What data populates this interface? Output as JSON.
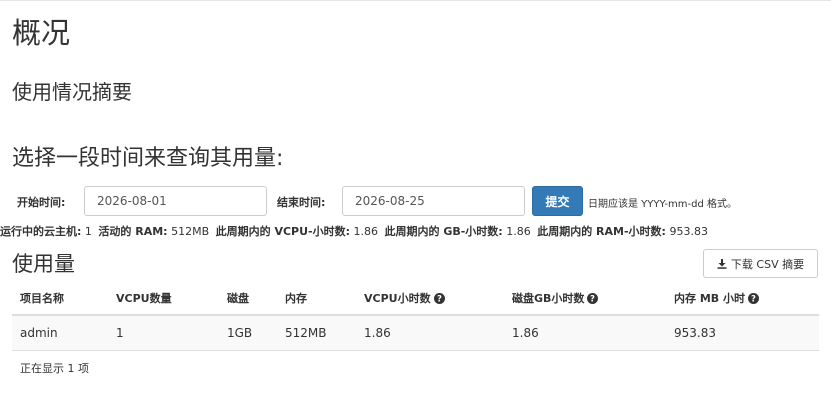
{
  "page": {
    "title": "概况",
    "summary_title": "使用情况摘要",
    "query_title": "选择一段时间来查询其用量:"
  },
  "form": {
    "start_label": "开始时间:",
    "start_value": "2026-08-01",
    "end_label": "结束时间:",
    "end_value": "2026-08-25",
    "submit_label": "提交",
    "hint": "日期应该是 YYYY-mm-dd 格式。"
  },
  "stats": {
    "instances_label": "运行中的云主机:",
    "instances_value": "1",
    "ram_label": "活动的 RAM:",
    "ram_value": "512MB",
    "vcpu_hours_label": "此周期内的 VCPU-小时数:",
    "vcpu_hours_value": "1.86",
    "gb_hours_label": "此周期内的 GB-小时数:",
    "gb_hours_value": "1.86",
    "ram_hours_label": "此周期内的 RAM-小时数:",
    "ram_hours_value": "953.83"
  },
  "usage": {
    "title": "使用量",
    "csv_button": "下载 CSV 摘要",
    "columns": [
      "项目名称",
      "VCPU数量",
      "磁盘",
      "内存",
      "VCPU小时数",
      "磁盘GB小时数",
      "内存 MB 小时"
    ],
    "rows": [
      [
        "admin",
        "1",
        "1GB",
        "512MB",
        "1.86",
        "1.86",
        "953.83"
      ]
    ],
    "footer": "正在显示 1 项"
  },
  "icons": {
    "download": "download-icon",
    "help": "question-circle-icon"
  },
  "colors": {
    "primary": "#337ab7",
    "border": "#dddddd",
    "row_bg": "#f9f9f9"
  }
}
